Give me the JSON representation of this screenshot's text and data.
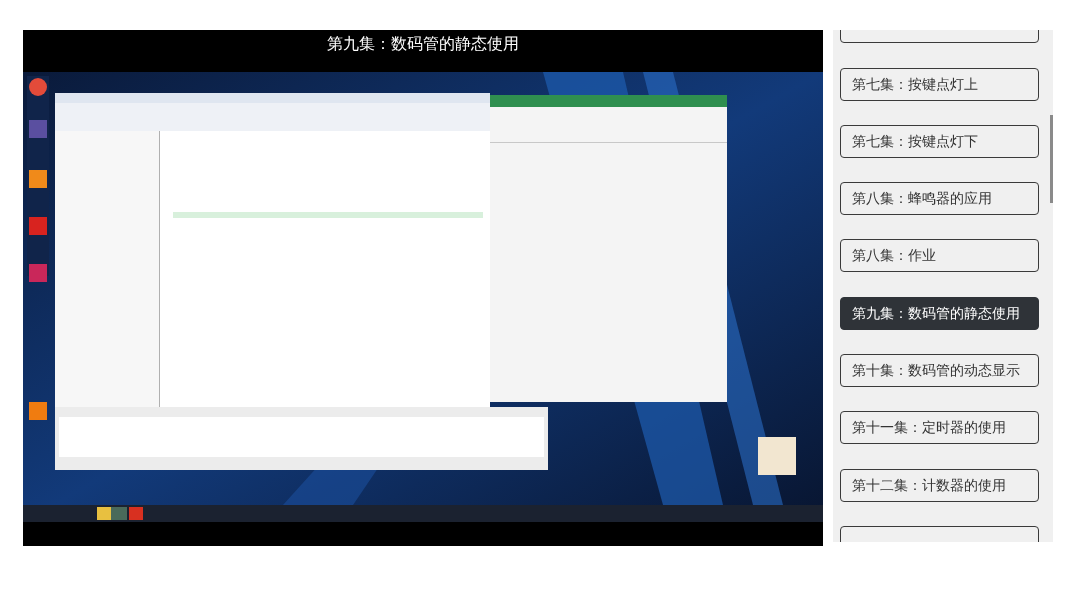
{
  "video": {
    "title": "第九集：数码管的静态使用"
  },
  "playlist": {
    "items": [
      {
        "selected": false
      },
      {
        "label": "第七集：按键点灯上",
        "selected": false
      },
      {
        "label": "第七集：按键点灯下",
        "selected": false
      },
      {
        "label": "第八集：蜂鸣器的应用",
        "selected": false
      },
      {
        "label": "第八集：作业",
        "selected": false
      },
      {
        "label": "第九集：数码管的静态使用",
        "selected": true
      },
      {
        "label": "第十集：数码管的动态显示",
        "selected": false
      },
      {
        "label": "第十一集：定时器的使用",
        "selected": false
      },
      {
        "label": "第十二集：计数器的使用",
        "selected": false
      },
      {
        "selected": false
      }
    ]
  }
}
